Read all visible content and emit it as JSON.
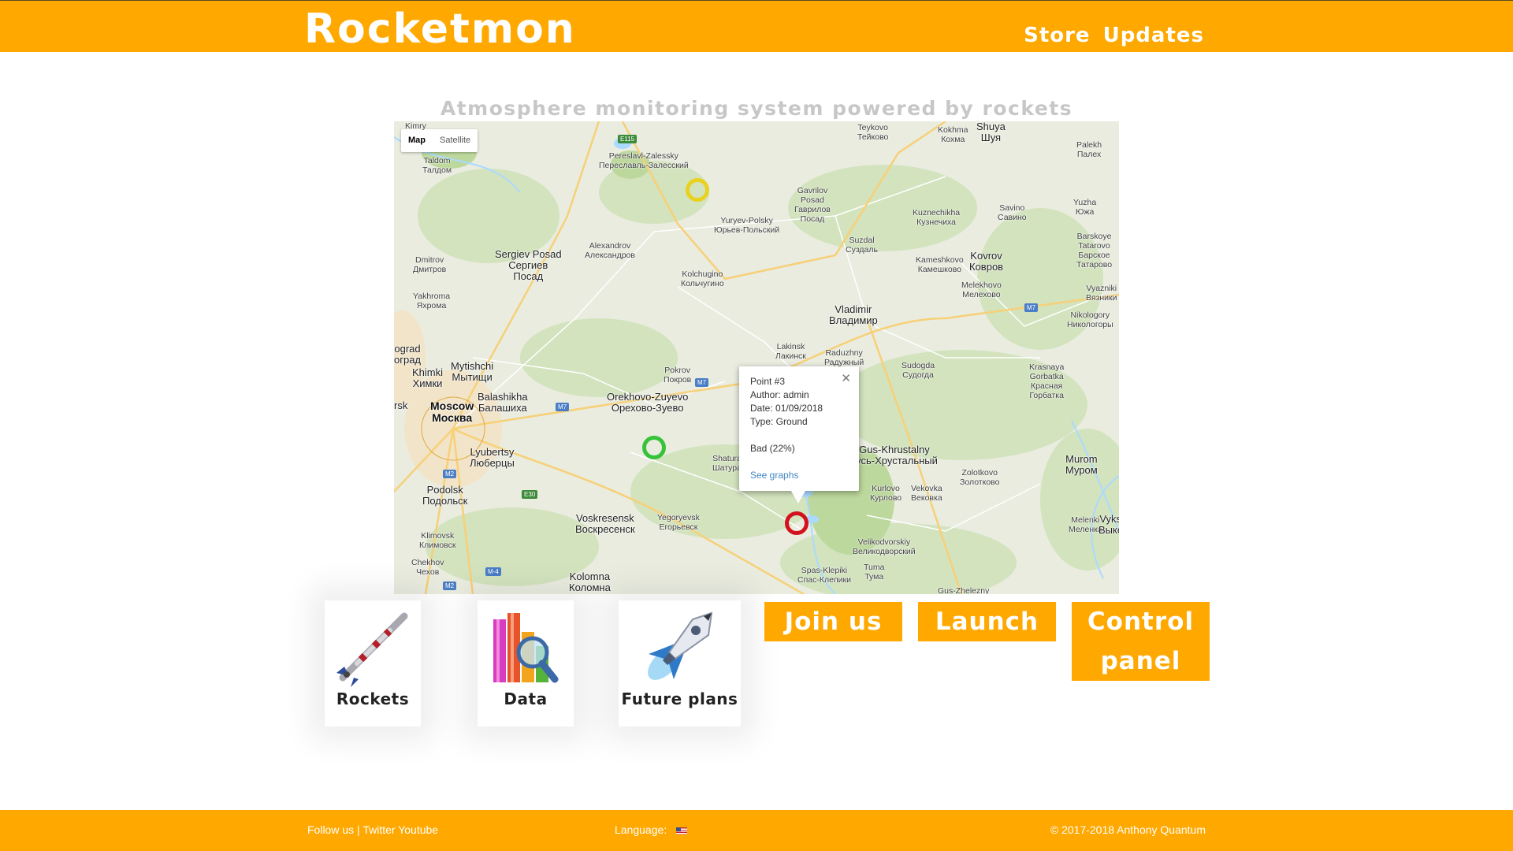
{
  "header": {
    "logo": "Rocketmon",
    "nav": [
      {
        "label": "Store"
      },
      {
        "label": "Updates"
      }
    ]
  },
  "tagline": "Atmosphere monitoring system powered by rockets",
  "map": {
    "type_control": {
      "map": "Map",
      "satellite": "Satellite",
      "selected": "Map"
    },
    "places": [
      "Kimry",
      "Taldom\nТалдом",
      "Pereslavl-Zalessky\nПереславль-Залесский",
      "Teykovo\nТейково",
      "Kokhma\nКохма",
      "Shuya\nШуя",
      "Palekh\nПалех",
      "Gavrilov\nPosad\nГаврилов\nПосад",
      "Yuryev-Polsky\nЮрьев-Польский",
      "Kuznechikha\nКузнечиха",
      "Savino\nСавино",
      "Yuzha\nЮжа",
      "Dmitrov\nДмитров",
      "Sergiev Posad\nСергиев\nПосад",
      "Alexandrov\nАлександров",
      "Kolchugino\nКольчугино",
      "Suzdal\nСуздаль",
      "Kameshkovo\nКамешково",
      "Kovrov\nКовров",
      "Barskoye\nTatarovo\nБарское\nТатарово",
      "Yakhroma\nЯхрома",
      "Melekhovo\nМелехово",
      "Vyazniki\nВязники",
      "Vladimir\nВладимир",
      "Nikologory\nНикологоры",
      "Lakinsk\nЛакинск",
      "Raduzhny\nРадужный",
      "ograd\nоград",
      "Mytishchi\nМытищи",
      "Khimki\nХимки",
      "Pokrov\nПокров",
      "Sudogda\nСудогда",
      "Krasnaya\nGorbatka\nКрасная\nГорбатка",
      "Balashikha\nБалашиха",
      "Orekhovo-Zuyevo\nОрехово-Зуево",
      "rsk",
      "Moscow\nМосква",
      "Lyubertsy\nЛюберцы",
      "Shatura\nШатура",
      "Gus-Khrustalny\nГусь-Хрустальный",
      "Murom\nМуром",
      "Zolotkovo\nЗолотково",
      "Podolsk\nПодольск",
      "Kurlovo\nКурлово",
      "Vekovka\nВековка",
      "Voskresensk\nВоскресенск",
      "Yegoryevsk\nЕгорьевск",
      "Melenki\nМеленки",
      "Vyksa\nВыкса",
      "Klimovsk\nКлимовск",
      "Velikodvorskiy\nВеликодворский",
      "Chekhov\nЧехов",
      "Kolomna\nКоломна",
      "Spas-Klepiki\nСпас-Клепики",
      "Tuma\nТума",
      "Gus-Zhelezny"
    ],
    "road_badges": [
      "E115",
      "M7",
      "M7",
      "M7",
      "M2",
      "E30",
      "M2",
      "M-4",
      "M2"
    ],
    "markers": [
      {
        "status": "moderate",
        "color": "#E8D21F"
      },
      {
        "status": "good",
        "color": "#36C339"
      },
      {
        "status": "bad",
        "color": "#D4121E"
      }
    ],
    "info_window": {
      "point": "Point #3",
      "author": "Author: admin",
      "date": "Date: 01/09/2018",
      "type": "Type: Ground",
      "quality": "Bad (22%)",
      "link": "See graphs"
    }
  },
  "tiles": [
    {
      "label": "Rockets",
      "icon": "rocket-icon"
    },
    {
      "label": "Data",
      "icon": "bar-chart-magnifier-icon"
    },
    {
      "label": "Future plans",
      "icon": "spaceship-icon"
    }
  ],
  "buttons": {
    "join": "Join us",
    "launch": "Launch",
    "control_1": "Control",
    "control_2": "panel"
  },
  "footer": {
    "follow": "Follow us |",
    "twitter": "Twitter",
    "youtube": "Youtube",
    "language_label": "Language:",
    "language_flag": "us-flag-icon",
    "copyright": "© 2017-2018 Anthony Quantum"
  },
  "colors": {
    "brand": "#FFA800",
    "tagline": "#C7C7C7",
    "link": "#4285C4"
  }
}
